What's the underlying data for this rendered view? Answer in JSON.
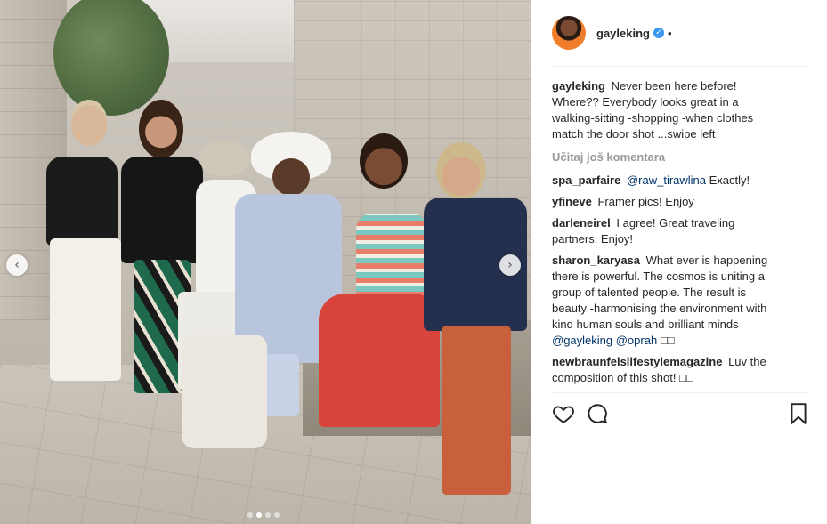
{
  "post": {
    "username": "gayleking",
    "verified_badge": "✓",
    "separator": "•",
    "caption": "Never been here before! Where?? Everybody looks great in a walking-sitting -shopping -when clothes match the door shot ...swipe left",
    "load_more": "Učitaj još komentara",
    "carousel": {
      "total": 4,
      "active_index": 1,
      "prev_icon": "‹",
      "next_icon": "›"
    }
  },
  "comments": [
    {
      "user": "spa_parfaire",
      "mention": "@raw_tirawlina",
      "text": "Exactly!"
    },
    {
      "user": "yfineve",
      "text": "Framer pics! Enjoy"
    },
    {
      "user": "darleneirel",
      "text": "I agree! Great traveling partners. Enjoy!"
    },
    {
      "user": "sharon_karyasa",
      "text": "What ever is happening there is powerful. The cosmos is uniting a group of talented people. The result is beauty -harmonising the environment with kind human souls and brilliant minds",
      "mentions": "@gayleking @oprah",
      "emoji": "□□"
    },
    {
      "user": "newbraunfelslifestylemagazine",
      "text": "Luv the composition of this shot!",
      "emoji": "□□"
    }
  ],
  "actions": {
    "like_icon": "heart-icon",
    "comment_icon": "comment-bubble-icon",
    "save_icon": "bookmark-icon"
  },
  "colors": {
    "link": "#003569",
    "verified": "#3897f0",
    "muted": "#999999",
    "text": "#262626"
  }
}
